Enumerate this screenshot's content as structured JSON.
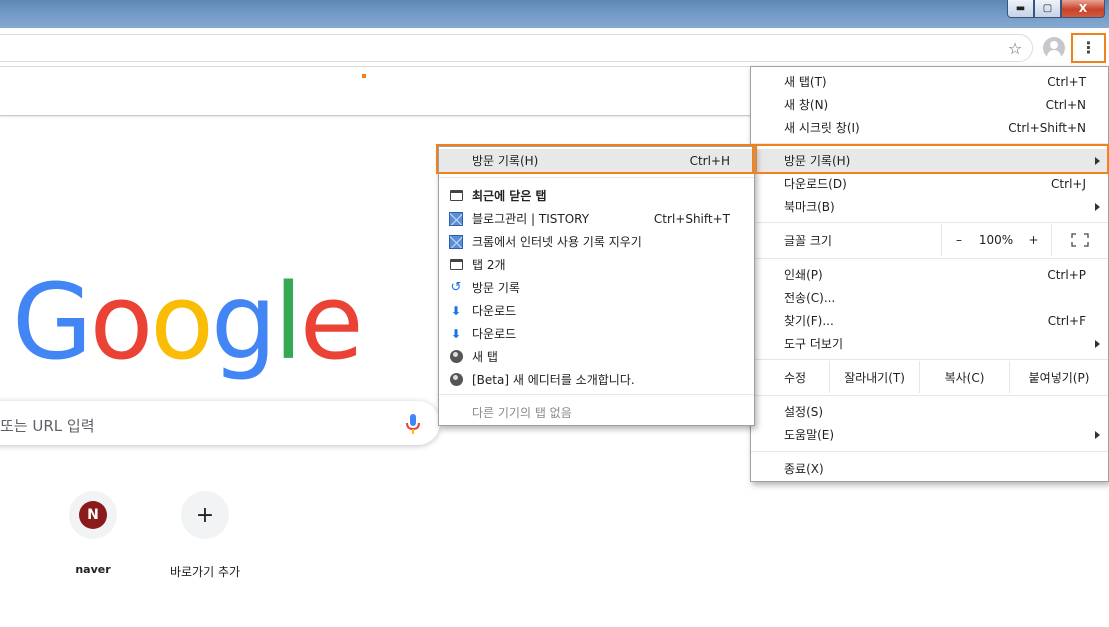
{
  "window": {
    "min_label": "▬",
    "max_label": "▢",
    "close_label": "X"
  },
  "toolbar": {
    "star": "☆",
    "menu_glyph": "⋮"
  },
  "newtab": {
    "logo": "Google",
    "search_placeholder": "또는 URL 입력",
    "shortcuts": [
      {
        "initial": "N",
        "label": "naver"
      },
      {
        "initial": "+",
        "label": "바로가기 추가"
      }
    ]
  },
  "main_menu": {
    "new_tab": {
      "label": "새 탭(T)",
      "shortcut": "Ctrl+T"
    },
    "new_window": {
      "label": "새 창(N)",
      "shortcut": "Ctrl+N"
    },
    "incognito": {
      "label": "새 시크릿 창(I)",
      "shortcut": "Ctrl+Shift+N"
    },
    "history": {
      "label": "방문 기록(H)"
    },
    "downloads": {
      "label": "다운로드(D)",
      "shortcut": "Ctrl+J"
    },
    "bookmarks": {
      "label": "북마크(B)"
    },
    "zoom": {
      "label": "글꼴 크기",
      "minus": "–",
      "value": "100%",
      "plus": "+"
    },
    "print": {
      "label": "인쇄(P)",
      "shortcut": "Ctrl+P"
    },
    "cast": {
      "label": "전송(C)..."
    },
    "find": {
      "label": "찾기(F)...",
      "shortcut": "Ctrl+F"
    },
    "more_tools": {
      "label": "도구 더보기"
    },
    "edit": {
      "label": "수정",
      "cut": "잘라내기(T)",
      "copy": "복사(C)",
      "paste": "붙여넣기(P)"
    },
    "settings": {
      "label": "설정(S)"
    },
    "help": {
      "label": "도움말(E)"
    },
    "exit": {
      "label": "종료(X)"
    }
  },
  "history_menu": {
    "history": {
      "label": "방문 기록(H)",
      "shortcut": "Ctrl+H"
    },
    "recent_header": "최근에 닫은 탭",
    "items": [
      {
        "icon": "tistory-icon",
        "label": "블로그관리 | TISTORY",
        "shortcut": "Ctrl+Shift+T"
      },
      {
        "icon": "tistory-icon",
        "label": "크롬에서 인터넷 사용 기록 지우기",
        "shortcut": ""
      },
      {
        "icon": "tab-icon",
        "label": "탭 2개",
        "shortcut": ""
      },
      {
        "icon": "history-icon",
        "label": "방문 기록",
        "shortcut": ""
      },
      {
        "icon": "download-icon",
        "label": "다운로드",
        "shortcut": ""
      },
      {
        "icon": "download-icon",
        "label": "다운로드",
        "shortcut": ""
      },
      {
        "icon": "globe-icon",
        "label": "새 탭",
        "shortcut": ""
      },
      {
        "icon": "globe-icon",
        "label": "[Beta] 새 에디터를 소개합니다.",
        "shortcut": ""
      }
    ],
    "no_other_devices": "다른 기기의 탭 없음"
  },
  "colors": {
    "highlight": "#f0821e",
    "google_blue": "#4285f4",
    "google_red": "#ea4335",
    "google_yellow": "#fbbc05",
    "google_green": "#34a853"
  }
}
